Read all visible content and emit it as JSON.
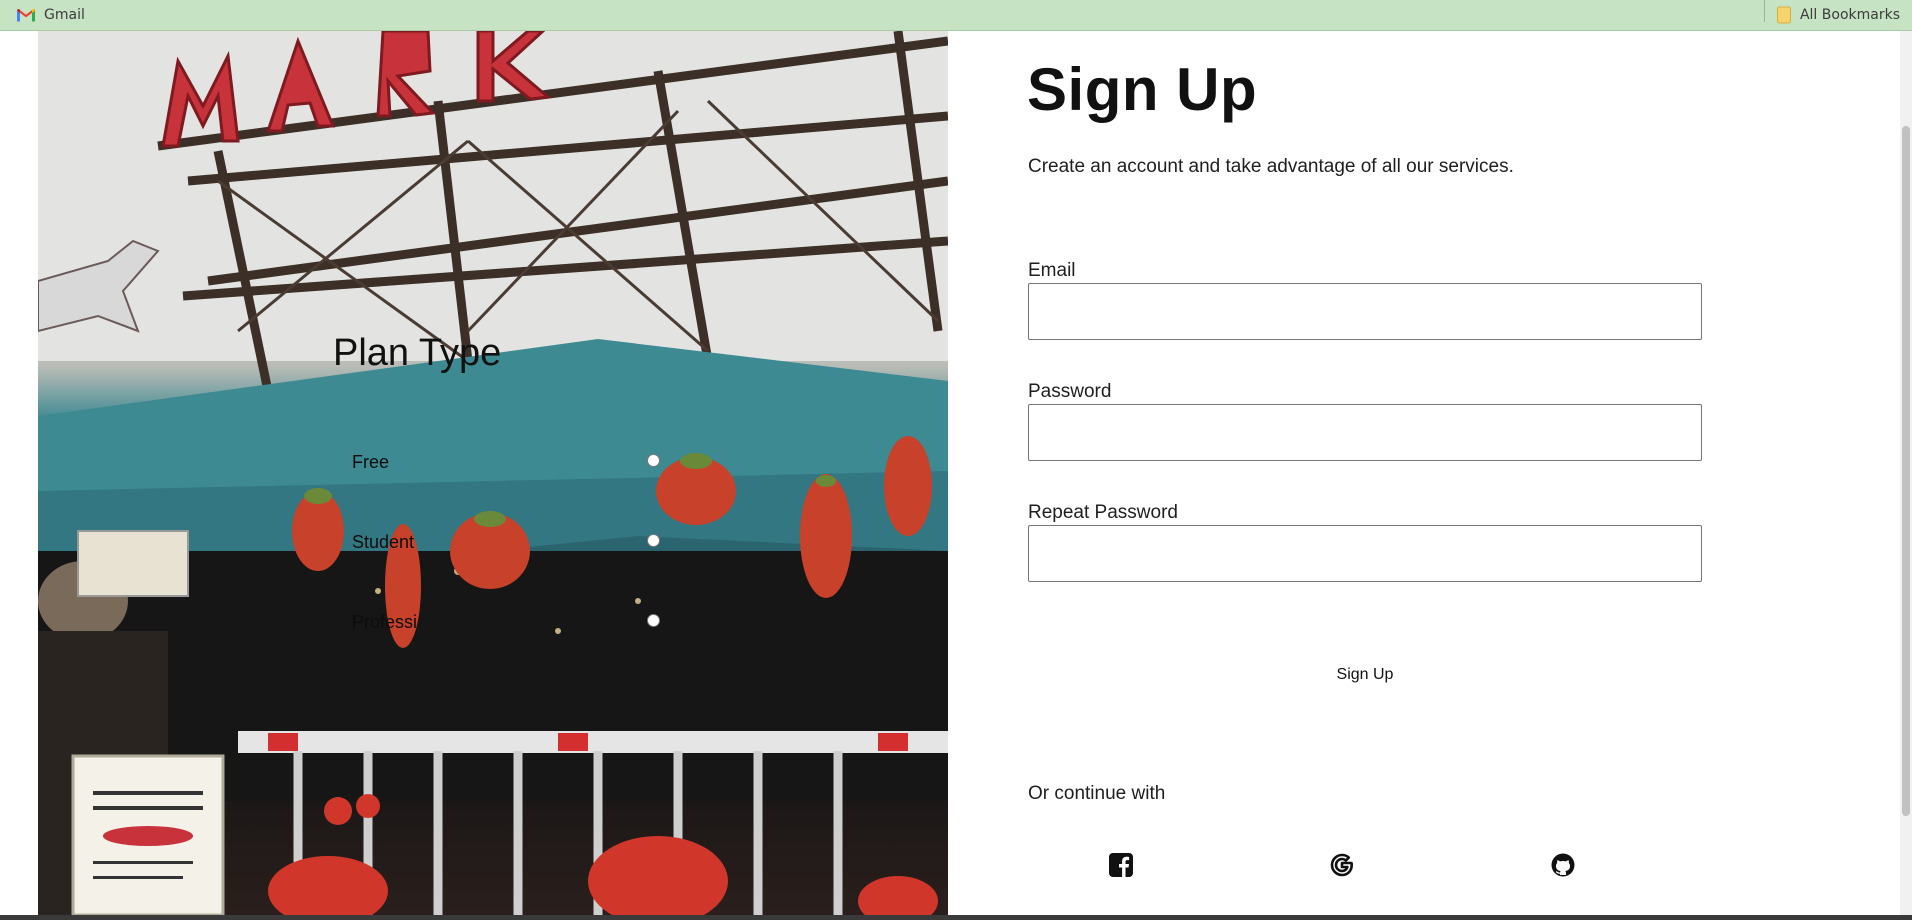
{
  "bookmarks_bar": {
    "items": [
      {
        "label": "Gmail",
        "icon": "gmail-icon"
      }
    ],
    "all_bookmarks": {
      "label": "All Bookmarks",
      "icon": "folder-icon"
    }
  },
  "plan_form": {
    "title": "Plan Type",
    "options": [
      {
        "label": "Free",
        "checked": false
      },
      {
        "label": "Student",
        "checked": false
      },
      {
        "label": "Professi",
        "checked": false
      }
    ]
  },
  "signup": {
    "title": "Sign Up",
    "subtitle": "Create an account and take advantage of all our services.",
    "fields": [
      {
        "label": "Email",
        "value": "",
        "type": "email"
      },
      {
        "label": "Password",
        "value": "",
        "type": "password"
      },
      {
        "label": "Repeat Password",
        "value": "",
        "type": "password"
      }
    ],
    "submit_label": "Sign Up",
    "continue_label": "Or continue with",
    "social": [
      {
        "icon": "facebook-icon"
      },
      {
        "icon": "google-icon"
      },
      {
        "icon": "github-icon"
      }
    ]
  },
  "colors": {
    "bookmarks_bar_bg": "#c6e3c4",
    "awning_teal": "#3e8a93",
    "text": "#1f1f1f"
  }
}
